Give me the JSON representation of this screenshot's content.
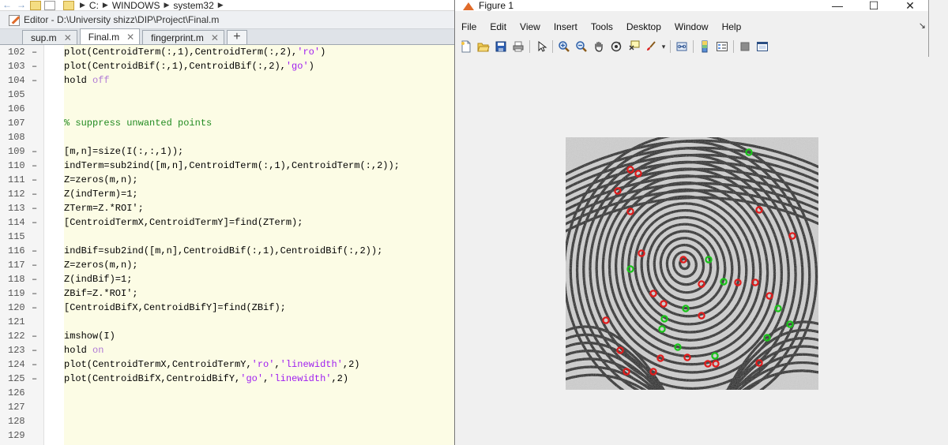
{
  "explorer": {
    "breadcrumbs": [
      "C:",
      "WINDOWS",
      "system32"
    ]
  },
  "editor": {
    "title": "Editor - D:\\University shizz\\DIP\\Project\\Final.m",
    "tabs": [
      {
        "label": "sup.m",
        "active": false
      },
      {
        "label": "Final.m",
        "active": true
      },
      {
        "label": "fingerprint.m",
        "active": false
      }
    ],
    "add_tab_label": "+",
    "lines": [
      {
        "num": "102",
        "dash": "–",
        "html": "    plot(CentroidTerm(:,1),CentroidTerm(:,2),<span class=\"str\">'ro'</span>)"
      },
      {
        "num": "103",
        "dash": "–",
        "html": "    plot(CentroidBif(:,1),CentroidBif(:,2),<span class=\"str\">'go'</span>)"
      },
      {
        "num": "104",
        "dash": "–",
        "html": "    hold <span class=\"kw\">off</span>"
      },
      {
        "num": "105",
        "dash": "",
        "html": ""
      },
      {
        "num": "106",
        "dash": "",
        "html": ""
      },
      {
        "num": "107",
        "dash": "",
        "html": "    <span class=\"cmt\">% suppress unwanted points</span>"
      },
      {
        "num": "108",
        "dash": "",
        "html": ""
      },
      {
        "num": "109",
        "dash": "–",
        "html": "    [m,n]=size(I(:,:,1));"
      },
      {
        "num": "110",
        "dash": "–",
        "html": "    indTerm=sub2ind([m,n],CentroidTerm(:,1),CentroidTerm(:,2));"
      },
      {
        "num": "111",
        "dash": "–",
        "html": "    Z=zeros(m,n);"
      },
      {
        "num": "112",
        "dash": "–",
        "html": "    Z(indTerm)=1;"
      },
      {
        "num": "113",
        "dash": "–",
        "html": "    ZTerm=Z.*ROI';"
      },
      {
        "num": "114",
        "dash": "–",
        "html": "    [CentroidTermX,CentroidTermY]=find(ZTerm);"
      },
      {
        "num": "115",
        "dash": "",
        "html": ""
      },
      {
        "num": "116",
        "dash": "–",
        "html": "    indBif=sub2ind([m,n],CentroidBif(:,1),CentroidBif(:,2));"
      },
      {
        "num": "117",
        "dash": "–",
        "html": "    Z=zeros(m,n);"
      },
      {
        "num": "118",
        "dash": "–",
        "html": "    Z(indBif)=1;"
      },
      {
        "num": "119",
        "dash": "–",
        "html": "    ZBif=Z.*ROI';"
      },
      {
        "num": "120",
        "dash": "–",
        "html": "    [CentroidBifX,CentroidBifY]=find(ZBif);"
      },
      {
        "num": "121",
        "dash": "",
        "html": ""
      },
      {
        "num": "122",
        "dash": "–",
        "html": "    imshow(I)"
      },
      {
        "num": "123",
        "dash": "–",
        "html": "    hold <span class=\"kw\">on</span>"
      },
      {
        "num": "124",
        "dash": "–",
        "html": "    plot(CentroidTermX,CentroidTermY,<span class=\"str\">'ro'</span>,<span class=\"str\">'linewidth'</span>,2)"
      },
      {
        "num": "125",
        "dash": "–",
        "html": "    plot(CentroidBifX,CentroidBifY,<span class=\"str\">'go'</span>,<span class=\"str\">'linewidth'</span>,2)"
      },
      {
        "num": "126",
        "dash": "",
        "html": ""
      },
      {
        "num": "127",
        "dash": "",
        "html": ""
      },
      {
        "num": "128",
        "dash": "",
        "html": ""
      },
      {
        "num": "129",
        "dash": "",
        "html": ""
      }
    ]
  },
  "figure": {
    "title": "Figure 1",
    "window_controls": [
      "—",
      "☐",
      "✕"
    ],
    "menus": [
      "File",
      "Edit",
      "View",
      "Insert",
      "Tools",
      "Desktop",
      "Window",
      "Help"
    ],
    "dock_arrow": "↘",
    "toolbar_icons": [
      "new-figure-icon",
      "open-file-icon",
      "save-icon",
      "print-icon",
      "edit-plot-arrow-icon",
      "zoom-in-icon",
      "zoom-out-icon",
      "pan-hand-icon",
      "rotate-3d-icon",
      "data-cursor-icon",
      "brush-icon",
      "link-plot-icon",
      "insert-colorbar-icon",
      "insert-legend-icon",
      "hide-plot-tools-icon",
      "show-plot-tools-icon"
    ],
    "colors": {
      "termination": "#e11b1b",
      "bifurcation": "#19c419",
      "ridge": "#121212"
    }
  },
  "chart_data": {
    "type": "scatter",
    "title": "",
    "xlabel": "",
    "ylabel": "",
    "image_size": [
      320,
      320
    ],
    "description_image": "fingerprint grayscale image",
    "series": [
      {
        "name": "",
        "marker": "ro",
        "color": "#e11b1b",
        "points": [
          [
            82,
            41
          ],
          [
            92,
            46
          ],
          [
            66,
            68
          ],
          [
            82,
            94
          ],
          [
            245,
            92
          ],
          [
            287,
            125
          ],
          [
            96,
            147
          ],
          [
            149,
            155
          ],
          [
            172,
            186
          ],
          [
            218,
            184
          ],
          [
            240,
            184
          ],
          [
            258,
            201
          ],
          [
            111,
            198
          ],
          [
            124,
            211
          ],
          [
            51,
            232
          ],
          [
            172,
            226
          ],
          [
            69,
            270
          ],
          [
            120,
            280
          ],
          [
            154,
            279
          ],
          [
            180,
            287
          ],
          [
            190,
            287
          ],
          [
            245,
            286
          ],
          [
            77,
            297
          ],
          [
            111,
            297
          ]
        ]
      },
      {
        "name": "",
        "marker": "go",
        "color": "#19c419",
        "points": [
          [
            232,
            19
          ],
          [
            181,
            155
          ],
          [
            82,
            167
          ],
          [
            200,
            183
          ],
          [
            152,
            217
          ],
          [
            269,
            217
          ],
          [
            125,
            230
          ],
          [
            284,
            237
          ],
          [
            122,
            243
          ],
          [
            255,
            254
          ],
          [
            142,
            266
          ],
          [
            189,
            277
          ]
        ]
      }
    ]
  }
}
